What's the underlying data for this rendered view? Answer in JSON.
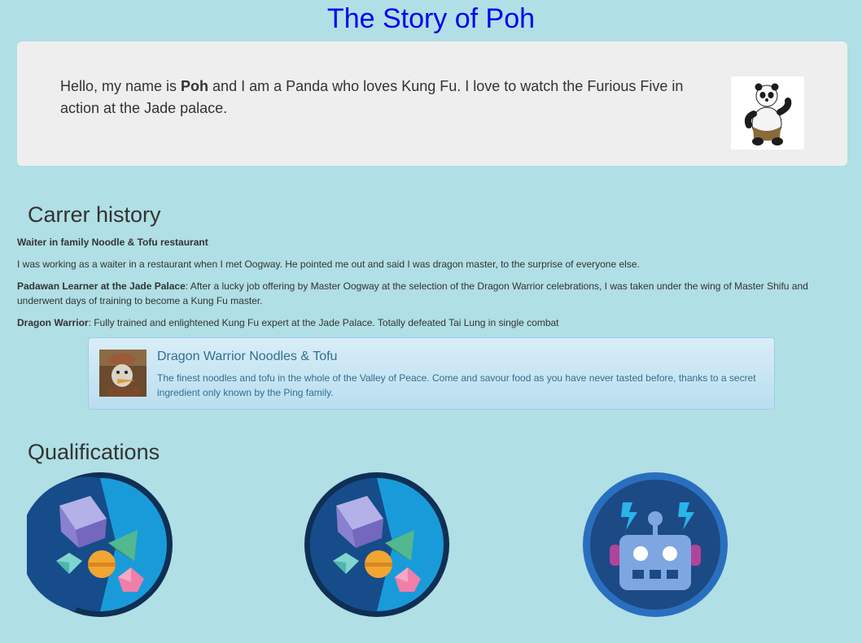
{
  "page": {
    "title": "The Story of Poh"
  },
  "intro": {
    "text_before": "Hello, my name is ",
    "name": "Poh",
    "text_after": " and I am a Panda who loves Kung Fu. I love to watch the Furious Five in action at the Jade palace."
  },
  "career": {
    "heading": "Carrer history",
    "items": [
      {
        "title": "Waiter in family Noodle & Tofu restaurant",
        "text": ""
      },
      {
        "title": "",
        "text": "I was working as a waiter in a restaurant when I met Oogway. He pointed me out and said I was dragon master, to the surprise of everyone else."
      },
      {
        "title": "Padawan Learner at the Jade Palace",
        "text": ": After a lucky job offering by Master Oogway at the selection of the Dragon Warrior celebrations, I was taken under the wing of Master Shifu and underwent days of training to become a Kung Fu master."
      },
      {
        "title": "Dragon Warrior",
        "text": ": Fully trained and enlightened Kung Fu expert at the Jade Palace. Totally defeated Tai Lung in single combat"
      }
    ]
  },
  "ad": {
    "heading": "Dragon Warrior Noodles & Tofu",
    "text": "The finest noodles and tofu in the whole of the Valley of Peace. Come and savour food as you have never tasted before, thanks to a secret ingredient only known by the Ping family."
  },
  "qualifications": {
    "heading": "Qualifications",
    "badges": [
      {
        "icon": "gems-badge-icon"
      },
      {
        "icon": "gems-badge-icon"
      },
      {
        "icon": "robot-badge-icon"
      }
    ]
  },
  "colors": {
    "background": "#b0dfe5",
    "title": "#0000ee",
    "jumbotron": "#eeeeee",
    "info_text": "#31708f"
  }
}
